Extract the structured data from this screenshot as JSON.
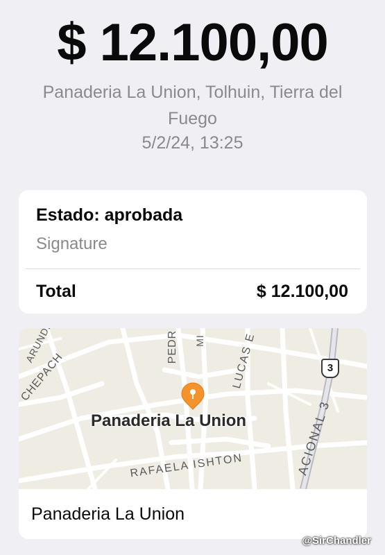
{
  "header": {
    "amount": "$ 12.100,00",
    "merchant_location": "Panaderia La Union, Tolhuin, Tierra del Fuego",
    "datetime": "5/2/24, 13:25"
  },
  "status_card": {
    "status": "Estado: aprobada",
    "method": "Signature",
    "total_label": "Total",
    "total_value": "$ 12.100,00"
  },
  "map": {
    "place_label": "Panaderia La Union",
    "street_labels": {
      "pedr": "PEDR",
      "mi": "MI",
      "lucas": "LUCAS E",
      "chepach": "CHEPACH",
      "arund": "ARUNDI",
      "rafaela": "RAFAELA ISHTON",
      "nacional": "ACIONAL 3"
    },
    "route_shield": "3",
    "pin_icon": "map-pin-icon"
  },
  "footer": {
    "place_name": "Panaderia La Union"
  },
  "watermark": "@SirChandler",
  "colors": {
    "background": "#efeff4",
    "card": "#ffffff",
    "secondary_text": "#8a8a8e",
    "map_land": "#efece4",
    "pin": "#f4922c"
  }
}
